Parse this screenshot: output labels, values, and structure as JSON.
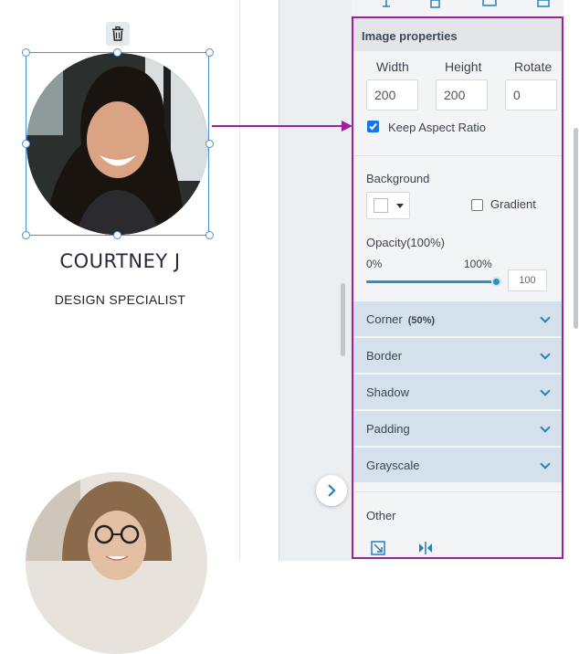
{
  "card1": {
    "name": "COURTNEY J",
    "title": "DESIGN SPECIALIST"
  },
  "panel": {
    "header": "Image properties",
    "width_label": "Width",
    "height_label": "Height",
    "rotate_label": "Rotate",
    "width_value": "200",
    "height_value": "200",
    "rotate_value": "0",
    "keep_aspect_label": "Keep Aspect Ratio",
    "keep_aspect_checked": true,
    "background_label": "Background",
    "gradient_label": "Gradient",
    "opacity_label": "Opacity(100%)",
    "opacity_min": "0%",
    "opacity_max": "100%",
    "opacity_value": "100",
    "accordions": [
      {
        "label": "Corner",
        "badge": "(50%)"
      },
      {
        "label": "Border",
        "badge": ""
      },
      {
        "label": "Shadow",
        "badge": ""
      },
      {
        "label": "Padding",
        "badge": ""
      },
      {
        "label": "Grayscale",
        "badge": ""
      }
    ],
    "other_label": "Other"
  },
  "colors": {
    "accent": "#2f8fc4",
    "highlight": "#a01f9a",
    "selection": "#4a90d9"
  },
  "icons": [
    "trash-icon",
    "chevron-right-icon",
    "chevron-down-icon",
    "resize-icon",
    "flip-icon"
  ]
}
